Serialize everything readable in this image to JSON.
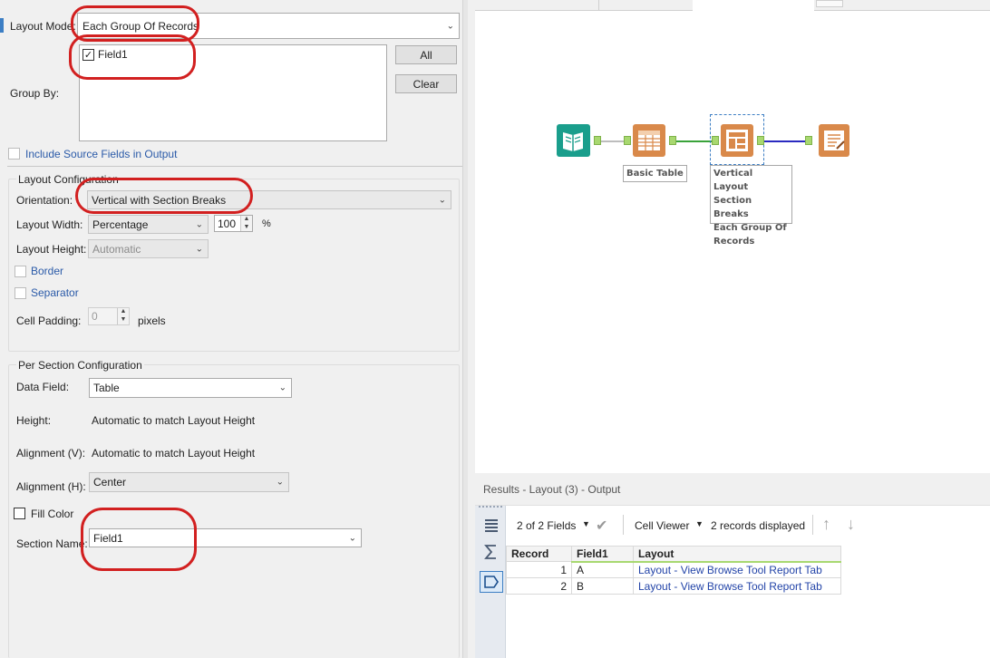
{
  "config": {
    "layout_mode_label": "Layout Mode:",
    "layout_mode_value": "Each Group Of Records",
    "group_by_label": "Group By:",
    "group_by_fields": [
      {
        "name": "Field1",
        "checked": true
      }
    ],
    "all_button": "All",
    "clear_button": "Clear",
    "include_source_fields": "Include Source Fields in Output",
    "layout_configuration": {
      "heading": "Layout Configuration",
      "orientation_label": "Orientation:",
      "orientation_value": "Vertical with Section Breaks",
      "layout_width_label": "Layout Width:",
      "layout_width_value": "Percentage",
      "layout_width_number": "100",
      "layout_width_unit": "%",
      "layout_height_label": "Layout Height:",
      "layout_height_value": "Automatic",
      "border_label": "Border",
      "separator_label": "Separator",
      "cell_padding_label": "Cell Padding:",
      "cell_padding_value": "0",
      "cell_padding_unit": "pixels"
    },
    "per_section": {
      "heading": "Per Section Configuration",
      "data_field_label": "Data Field:",
      "data_field_value": "Table",
      "height_label": "Height:",
      "height_value": "Automatic to match Layout Height",
      "alignment_v_label": "Alignment (V):",
      "alignment_v_value": "Automatic to match Layout Height",
      "alignment_h_label": "Alignment (H):",
      "alignment_h_value": "Center",
      "fill_color_label": "Fill Color",
      "section_name_label": "Section Name:",
      "section_name_value": "Field1"
    }
  },
  "canvas": {
    "tools": [
      {
        "name": "Input",
        "icon": "book-icon",
        "color": "#1a9e8c"
      },
      {
        "name": "Basic Table",
        "icon": "table-icon",
        "color": "#d9894a",
        "label": "Basic Table"
      },
      {
        "name": "Layout",
        "icon": "layout-icon",
        "color": "#d9894a",
        "label_lines": [
          "Vertical Layout",
          "Section Breaks",
          "Each Group Of",
          "Records"
        ]
      },
      {
        "name": "Render",
        "icon": "document-icon",
        "color": "#d9894a"
      }
    ]
  },
  "results": {
    "title": "Results - Layout (3) - Output",
    "fields_count": "2 of 2 Fields",
    "cell_viewer": "Cell Viewer",
    "records_displayed": "2 records displayed",
    "columns": [
      "Record",
      "Field1",
      "Layout"
    ],
    "rows": [
      {
        "record": "1",
        "field1": "A",
        "layout": "Layout - View Browse Tool Report Tab"
      },
      {
        "record": "2",
        "field1": "B",
        "layout": "Layout - View Browse Tool Report Tab"
      }
    ]
  },
  "colors": {
    "annotation": "#d22020",
    "connector_green": "#3aa33a",
    "connector_blue": "#2a2ac0"
  }
}
